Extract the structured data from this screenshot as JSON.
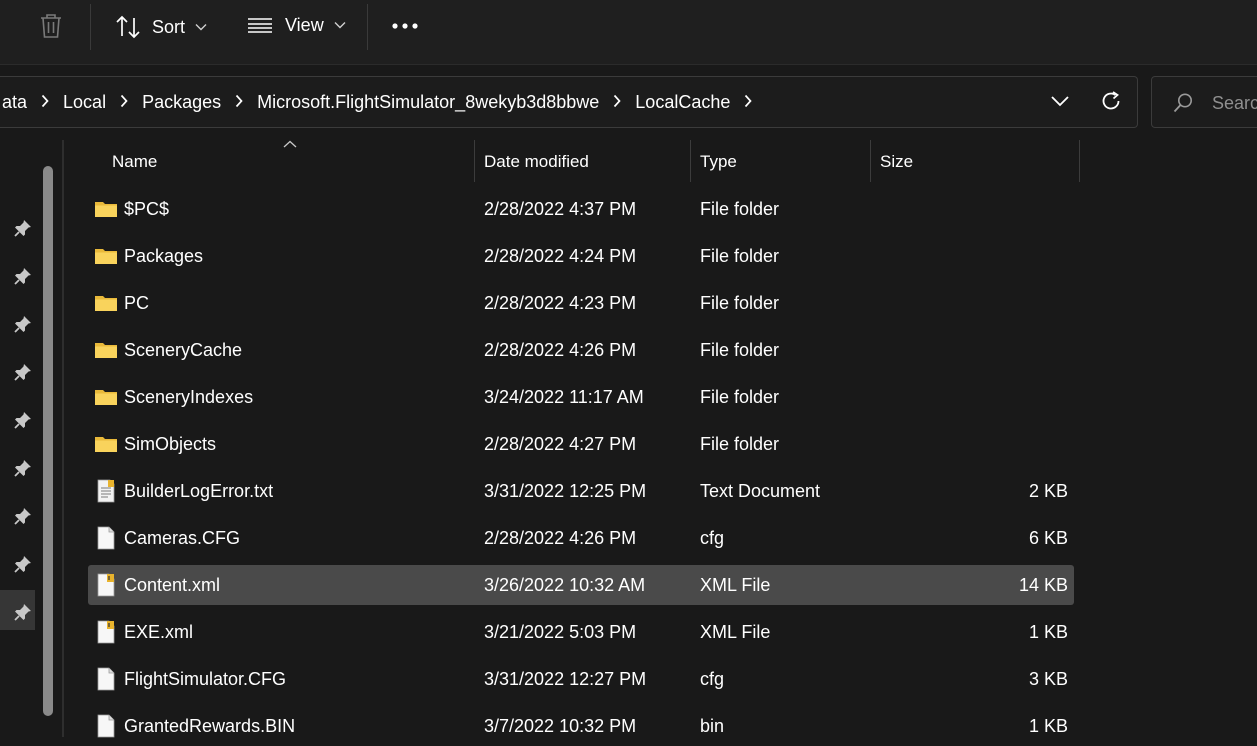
{
  "toolbar": {
    "sort_label": "Sort",
    "view_label": "View"
  },
  "address": {
    "crumbs": [
      "ata",
      "Local",
      "Packages",
      "Microsoft.FlightSimulator_8wekyb3d8bbwe",
      "LocalCache"
    ]
  },
  "search": {
    "placeholder": "Search"
  },
  "columns": {
    "name": "Name",
    "date": "Date modified",
    "type": "Type",
    "size": "Size"
  },
  "files": [
    {
      "name": "$PC$",
      "date": "2/28/2022 4:37 PM",
      "type": "File folder",
      "size": "",
      "icon": "folder-icon"
    },
    {
      "name": "Packages",
      "date": "2/28/2022 4:24 PM",
      "type": "File folder",
      "size": "",
      "icon": "folder-icon"
    },
    {
      "name": "PC",
      "date": "2/28/2022 4:23 PM",
      "type": "File folder",
      "size": "",
      "icon": "folder-icon"
    },
    {
      "name": "SceneryCache",
      "date": "2/28/2022 4:26 PM",
      "type": "File folder",
      "size": "",
      "icon": "folder-icon"
    },
    {
      "name": "SceneryIndexes",
      "date": "3/24/2022 11:17 AM",
      "type": "File folder",
      "size": "",
      "icon": "folder-icon"
    },
    {
      "name": "SimObjects",
      "date": "2/28/2022 4:27 PM",
      "type": "File folder",
      "size": "",
      "icon": "folder-icon"
    },
    {
      "name": "BuilderLogError.txt",
      "date": "3/31/2022 12:25 PM",
      "type": "Text Document",
      "size": "2 KB",
      "icon": "text-document-icon"
    },
    {
      "name": "Cameras.CFG",
      "date": "2/28/2022 4:26 PM",
      "type": "cfg",
      "size": "6 KB",
      "icon": "file-icon"
    },
    {
      "name": "Content.xml",
      "date": "3/26/2022 10:32 AM",
      "type": "XML File",
      "size": "14 KB",
      "icon": "xml-file-icon",
      "selected": true
    },
    {
      "name": "EXE.xml",
      "date": "3/21/2022 5:03 PM",
      "type": "XML File",
      "size": "1 KB",
      "icon": "xml-file-icon"
    },
    {
      "name": "FlightSimulator.CFG",
      "date": "3/31/2022 12:27 PM",
      "type": "cfg",
      "size": "3 KB",
      "icon": "file-icon"
    },
    {
      "name": "GrantedRewards.BIN",
      "date": "3/7/2022 10:32 PM",
      "type": "bin",
      "size": "1 KB",
      "icon": "file-icon"
    }
  ],
  "colors": {
    "background": "#191919",
    "selected_row": "#4a4a4a",
    "folder": "#f7c948",
    "lock_badge": "#e8b32d"
  }
}
